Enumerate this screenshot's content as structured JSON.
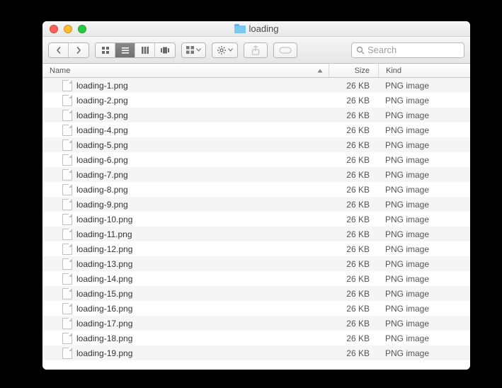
{
  "window": {
    "title": "loading"
  },
  "toolbar": {
    "search_placeholder": "Search"
  },
  "columns": {
    "name": "Name",
    "size": "Size",
    "kind": "Kind"
  },
  "files": [
    {
      "name": "loading-1.png",
      "size": "26 KB",
      "kind": "PNG image"
    },
    {
      "name": "loading-2.png",
      "size": "26 KB",
      "kind": "PNG image"
    },
    {
      "name": "loading-3.png",
      "size": "26 KB",
      "kind": "PNG image"
    },
    {
      "name": "loading-4.png",
      "size": "26 KB",
      "kind": "PNG image"
    },
    {
      "name": "loading-5.png",
      "size": "26 KB",
      "kind": "PNG image"
    },
    {
      "name": "loading-6.png",
      "size": "26 KB",
      "kind": "PNG image"
    },
    {
      "name": "loading-7.png",
      "size": "26 KB",
      "kind": "PNG image"
    },
    {
      "name": "loading-8.png",
      "size": "26 KB",
      "kind": "PNG image"
    },
    {
      "name": "loading-9.png",
      "size": "26 KB",
      "kind": "PNG image"
    },
    {
      "name": "loading-10.png",
      "size": "26 KB",
      "kind": "PNG image"
    },
    {
      "name": "loading-11.png",
      "size": "26 KB",
      "kind": "PNG image"
    },
    {
      "name": "loading-12.png",
      "size": "26 KB",
      "kind": "PNG image"
    },
    {
      "name": "loading-13.png",
      "size": "26 KB",
      "kind": "PNG image"
    },
    {
      "name": "loading-14.png",
      "size": "26 KB",
      "kind": "PNG image"
    },
    {
      "name": "loading-15.png",
      "size": "26 KB",
      "kind": "PNG image"
    },
    {
      "name": "loading-16.png",
      "size": "26 KB",
      "kind": "PNG image"
    },
    {
      "name": "loading-17.png",
      "size": "26 KB",
      "kind": "PNG image"
    },
    {
      "name": "loading-18.png",
      "size": "26 KB",
      "kind": "PNG image"
    },
    {
      "name": "loading-19.png",
      "size": "26 KB",
      "kind": "PNG image"
    }
  ]
}
